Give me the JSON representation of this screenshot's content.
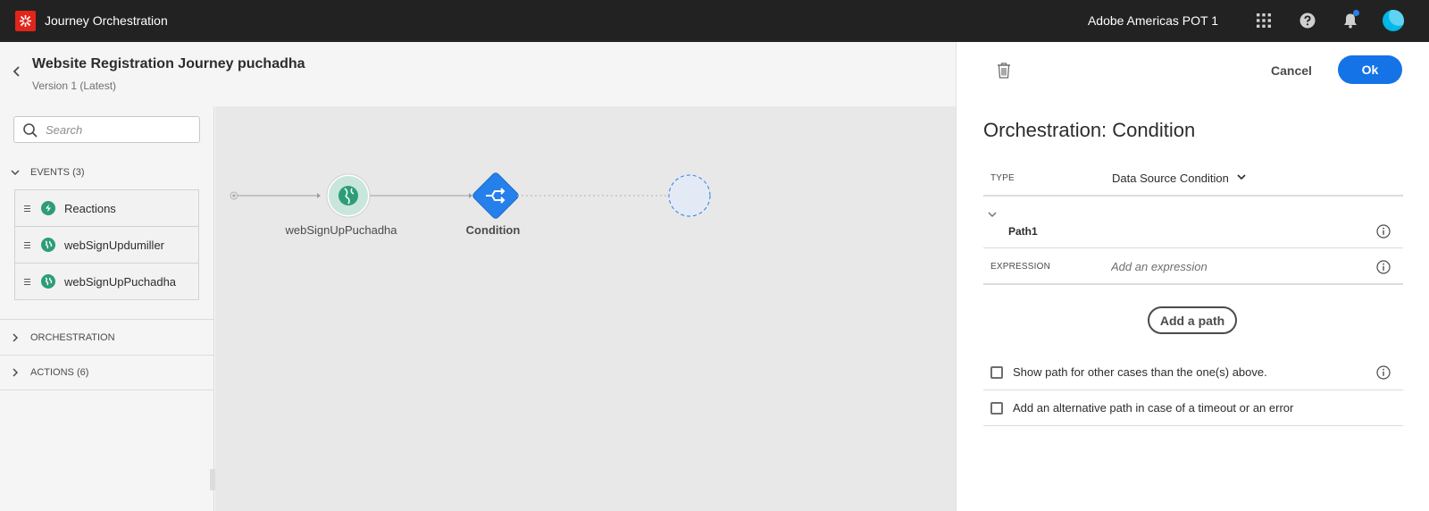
{
  "topbar": {
    "app_title": "Journey Orchestration",
    "org_name": "Adobe Americas POT 1",
    "icons": [
      "adobe-logo-icon",
      "apps-grid-icon",
      "help-icon",
      "bell-icon",
      "avatar"
    ],
    "accent_color": "#e1251b"
  },
  "header": {
    "title": "Website Registration Journey puchadha",
    "version": "Version 1 (Latest)"
  },
  "sidebar": {
    "search_placeholder": "Search",
    "events_section": "EVENTS (3)",
    "events": [
      {
        "label": "Reactions",
        "icon": "lightning-icon"
      },
      {
        "label": "webSignUpdumiller",
        "icon": "globe-icon"
      },
      {
        "label": "webSignUpPuchadha",
        "icon": "globe-icon"
      }
    ],
    "orchestration_section": "ORCHESTRATION",
    "actions_section": "ACTIONS (6)"
  },
  "canvas": {
    "nodes": [
      {
        "label": "webSignUpPuchadha",
        "kind": "event",
        "icon": "globe-icon"
      },
      {
        "label": "Condition",
        "kind": "condition",
        "icon": "condition-split-icon"
      },
      {
        "label": "",
        "kind": "placeholder"
      }
    ]
  },
  "panel": {
    "cancel_label": "Cancel",
    "ok_label": "Ok",
    "title": "Orchestration: Condition",
    "type_label": "TYPE",
    "type_value": "Data Source Condition",
    "path_name": "Path1",
    "expression_label": "EXPRESSION",
    "expression_placeholder": "Add an expression",
    "add_path_label": "Add a path",
    "option_other_cases": "Show path for other cases than the one(s) above.",
    "option_timeout": "Add an alternative path in case of a timeout or an error",
    "primary_color": "#1473e6"
  }
}
